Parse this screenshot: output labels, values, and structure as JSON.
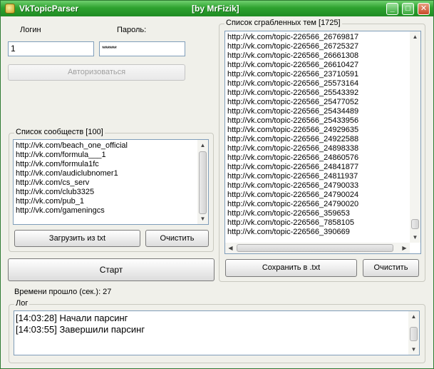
{
  "window": {
    "title": "VkTopicParser",
    "subtitle": "[by MrFizik]",
    "minimize_glyph": "_",
    "maximize_glyph": "□",
    "close_glyph": "✕"
  },
  "auth": {
    "login_label": "Логин",
    "password_label": "Пароль:",
    "login_value": "1",
    "password_value": "********",
    "authorize_button": "Авторизоваться"
  },
  "communities": {
    "title": "Список сообществ [100]",
    "items": [
      "http://vk.com/beach_one_official",
      "http://vk.com/formula___1",
      "http://vk.com/formula1fc",
      "http://vk.com/audiclubnomer1",
      "http://vk.com/cs_serv",
      "http://vk.com/club3325",
      "http://vk.com/pub_1",
      "http://vk.com/gameningcs"
    ],
    "load_button": "Загрузить из txt",
    "clear_button": "Очистить"
  },
  "start_button": "Старт",
  "elapsed_text": "Времени прошло (сек.): 27",
  "topics": {
    "title": "Список сграбленных тем [1725]",
    "items": [
      "http://vk.com/topic-226566_26769817",
      "http://vk.com/topic-226566_26725327",
      "http://vk.com/topic-226566_26661308",
      "http://vk.com/topic-226566_26610427",
      "http://vk.com/topic-226566_23710591",
      "http://vk.com/topic-226566_25573164",
      "http://vk.com/topic-226566_25543392",
      "http://vk.com/topic-226566_25477052",
      "http://vk.com/topic-226566_25434489",
      "http://vk.com/topic-226566_25433956",
      "http://vk.com/topic-226566_24929635",
      "http://vk.com/topic-226566_24922588",
      "http://vk.com/topic-226566_24898338",
      "http://vk.com/topic-226566_24860576",
      "http://vk.com/topic-226566_24841877",
      "http://vk.com/topic-226566_24811937",
      "http://vk.com/topic-226566_24790033",
      "http://vk.com/topic-226566_24790024",
      "http://vk.com/topic-226566_24790020",
      "http://vk.com/topic-226566_359653",
      "http://vk.com/topic-226566_7858105",
      "http://vk.com/topic-226566_390669"
    ],
    "save_button": "Сохранить в .txt",
    "clear_button": "Очистить"
  },
  "log": {
    "title": "Лог",
    "lines": [
      "[14:03:28] Начали парсинг",
      "[14:03:55] Завершили парсинг"
    ]
  },
  "scroll_glyphs": {
    "up": "▲",
    "down": "▼",
    "left": "◀",
    "right": "▶"
  }
}
